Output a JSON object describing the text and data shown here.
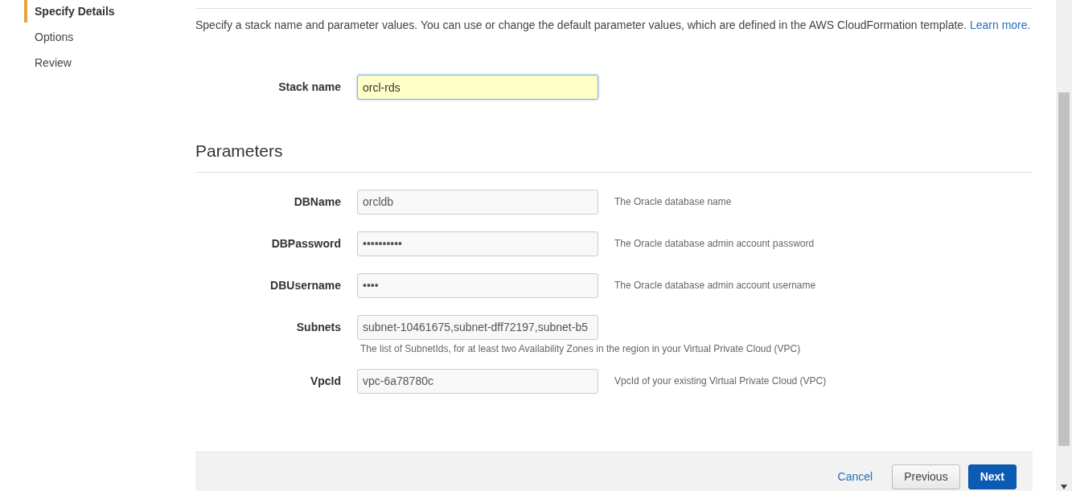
{
  "sidebar": {
    "items": [
      {
        "label": "Specify Details",
        "selected": true
      },
      {
        "label": "Options",
        "selected": false
      },
      {
        "label": "Review",
        "selected": false
      }
    ]
  },
  "description": {
    "text": "Specify a stack name and parameter values. You can use or change the default parameter values, which are defined in the AWS CloudFormation template.",
    "link": "Learn more."
  },
  "stack_name": {
    "label": "Stack name",
    "value": "orcl-rds"
  },
  "parameters": {
    "title": "Parameters",
    "rows": [
      {
        "label": "DBName",
        "value": "orcldb",
        "help": "The Oracle database name",
        "kind": "side"
      },
      {
        "label": "DBPassword",
        "value": "••••••••••",
        "help": "The Oracle database admin account password",
        "kind": "side"
      },
      {
        "label": "DBUsername",
        "value": "••••",
        "help": "The Oracle database admin account username",
        "kind": "side"
      },
      {
        "label": "Subnets",
        "value": "subnet-10461675,subnet-dff72197,subnet-b5",
        "help": "The list of SubnetIds, for at least two Availability Zones in the region in your Virtual Private Cloud (VPC)",
        "kind": "below"
      },
      {
        "label": "VpcId",
        "value": "vpc-6a78780c",
        "help": "VpcId of your existing Virtual Private Cloud (VPC)",
        "kind": "side"
      }
    ]
  },
  "footer": {
    "buttons": [
      {
        "label": "Cancel",
        "kind": "link"
      },
      {
        "label": "Previous",
        "kind": "secondary"
      },
      {
        "label": "Next",
        "kind": "primary"
      }
    ]
  }
}
